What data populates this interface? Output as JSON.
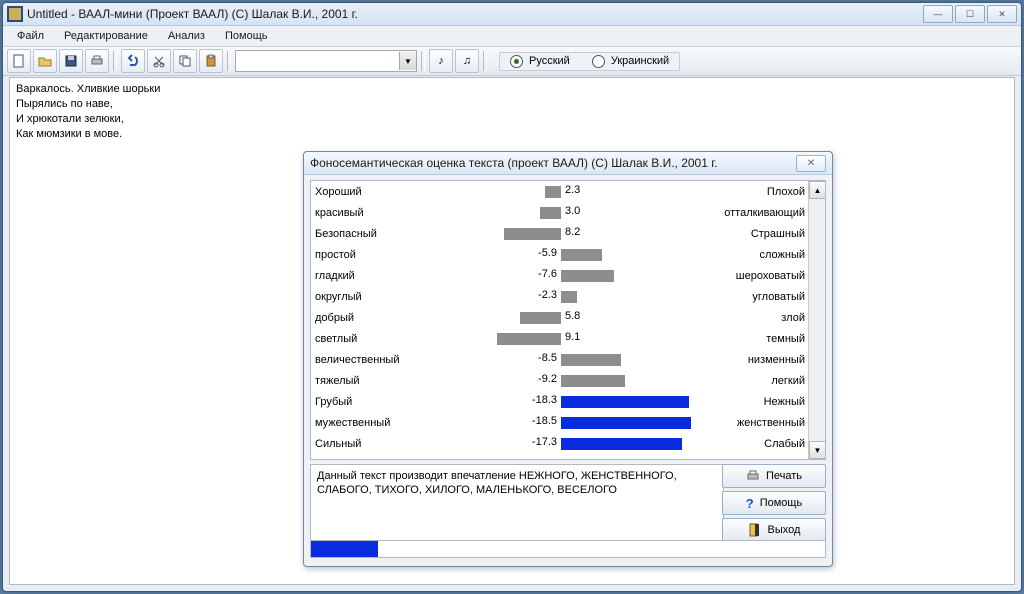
{
  "title": "Untitled - ВААЛ-мини (Проект ВААЛ) (C) Шалак В.И., 2001 г.",
  "menu": {
    "file": "Файл",
    "edit": "Редактирование",
    "analysis": "Анализ",
    "help": "Помощь"
  },
  "radios": {
    "russian": "Русский",
    "ukrainian": "Украинский",
    "selected": "russian"
  },
  "editor_lines": [
    "Варкалось. Хливкие шорьки",
    "Пырялись по наве,",
    "И хрюкотали зелюки,",
    "Как мюмзики в мове."
  ],
  "dialog": {
    "title": "Фоносемантическая оценка текста (проект ВААЛ) (C) Шалак В.И., 2001 г.",
    "rows": [
      {
        "left": "Хороший",
        "value": 2.3,
        "right": "Плохой",
        "color": "#8d8d8d"
      },
      {
        "left": "красивый",
        "value": 3.0,
        "right": "отталкивающий",
        "color": "#8d8d8d"
      },
      {
        "left": "Безопасный",
        "value": 8.2,
        "right": "Страшный",
        "color": "#8d8d8d"
      },
      {
        "left": "простой",
        "value": -5.9,
        "right": "сложный",
        "color": "#8d8d8d"
      },
      {
        "left": "гладкий",
        "value": -7.6,
        "right": "шероховатый",
        "color": "#8d8d8d"
      },
      {
        "left": "округлый",
        "value": -2.3,
        "right": "угловатый",
        "color": "#8d8d8d"
      },
      {
        "left": "добрый",
        "value": 5.8,
        "right": "злой",
        "color": "#8d8d8d"
      },
      {
        "left": "светлый",
        "value": 9.1,
        "right": "темный",
        "color": "#8d8d8d"
      },
      {
        "left": "величественный",
        "value": -8.5,
        "right": "низменный",
        "color": "#8d8d8d"
      },
      {
        "left": "тяжелый",
        "value": -9.2,
        "right": "легкий",
        "color": "#8d8d8d"
      },
      {
        "left": "Грубый",
        "value": -18.3,
        "right": "Нежный",
        "color": "#0a2be0"
      },
      {
        "left": "мужественный",
        "value": -18.5,
        "right": "женственный",
        "color": "#0a2be0"
      },
      {
        "left": "Сильный",
        "value": -17.3,
        "right": "Слабый",
        "color": "#0a2be0"
      }
    ],
    "impression": "Данный текст производит впечатление  НЕЖНОГО, ЖЕНСТВЕННОГО, СЛАБОГО, ТИХОГО, ХИЛОГО, МАЛЕНЬКОГО, ВЕСЕЛОГО",
    "buttons": {
      "print": "Печать",
      "help": "Помощь",
      "exit": "Выход"
    },
    "progress_pct": 13
  },
  "chart_data": {
    "type": "bar",
    "orientation": "diverging-horizontal",
    "categories": [
      "Хороший",
      "красивый",
      "Безопасный",
      "простой",
      "гладкий",
      "округлый",
      "добрый",
      "светлый",
      "величественный",
      "тяжелый",
      "Грубый",
      "мужественный",
      "Сильный"
    ],
    "values": [
      2.3,
      3.0,
      8.2,
      -5.9,
      -7.6,
      -2.3,
      5.8,
      9.1,
      -8.5,
      -9.2,
      -18.3,
      -18.5,
      -17.3
    ],
    "right_labels": [
      "Плохой",
      "отталкивающий",
      "Страшный",
      "сложный",
      "шероховатый",
      "угловатый",
      "злой",
      "темный",
      "низменный",
      "легкий",
      "Нежный",
      "женственный",
      "Слабый"
    ],
    "title": "Фоносемантическая оценка текста",
    "xlabel": "",
    "ylabel": "",
    "xlim": [
      -20,
      20
    ]
  }
}
